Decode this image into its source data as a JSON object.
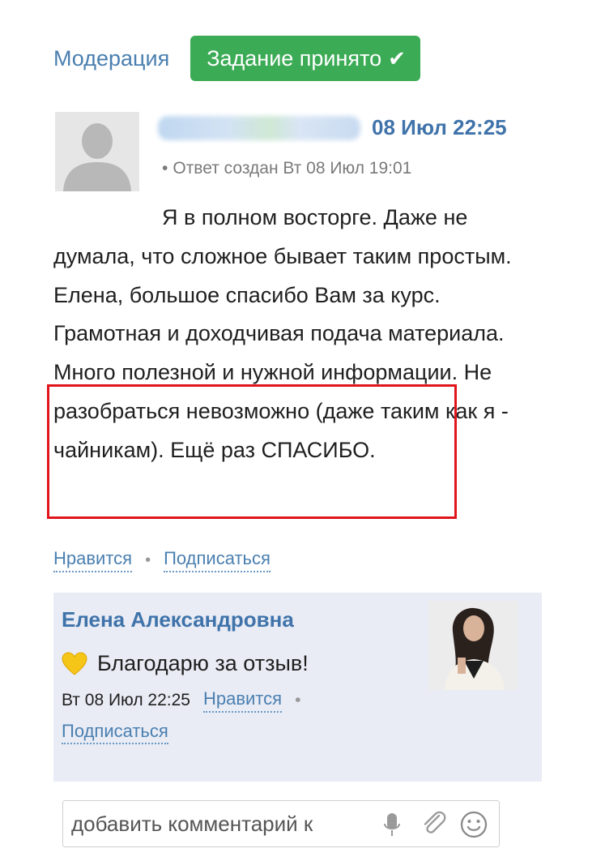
{
  "header": {
    "moderation_link": "Модерация",
    "status_badge": "Задание принято",
    "status_icon": "check-icon"
  },
  "review": {
    "date": "08 Июл 22:25",
    "answer_meta": "Ответ создан Вт 08 Июл 19:01",
    "text": "Я в полном восторге. Даже не думала, что сложное бывает таким простым. Елена, большое спасибо Вам за курс. Грамотная и доходчивая подача материала. Много полезной и нужной информации. Не разобраться невозможно (даже таким как я - чайникам). Ещё раз СПАСИБО.",
    "highlight_color": "#e0141b"
  },
  "actions": {
    "like": "Нравится",
    "subscribe": "Подписаться"
  },
  "reply": {
    "author": "Елена Александровна",
    "text": "Благодарю за отзыв!",
    "meta": "Вт 08 Июл 22:25",
    "like": "Нравится",
    "subscribe": "Подписаться"
  },
  "comment": {
    "placeholder": "добавить комментарий к"
  },
  "colors": {
    "accent": "#4a7fb0",
    "success": "#3cab56",
    "reply_bg": "#e9ecf5"
  }
}
